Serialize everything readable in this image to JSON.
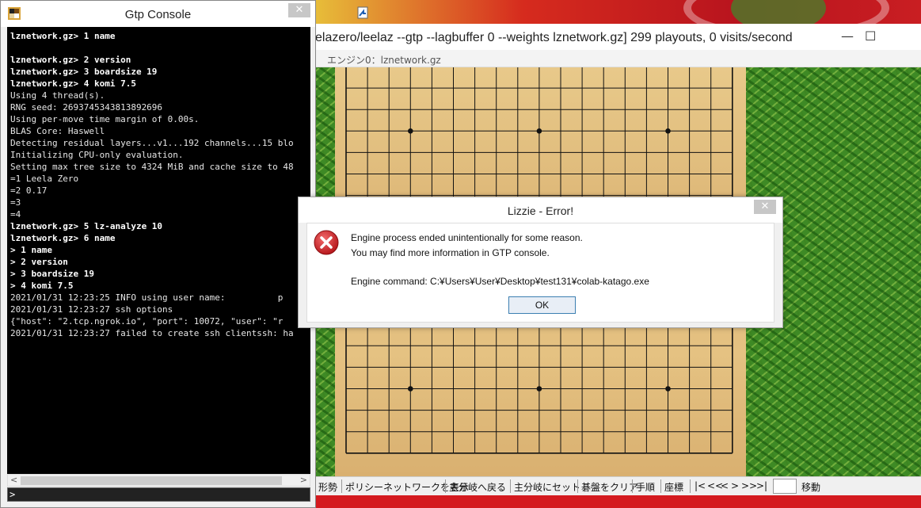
{
  "gtp_console": {
    "title": "Gtp Console",
    "close_label": "✕",
    "lines": [
      {
        "text": "lznetwork.gz> 1 name",
        "bold": true
      },
      {
        "text": "",
        "bold": false
      },
      {
        "text": "lznetwork.gz> 2 version",
        "bold": true
      },
      {
        "text": "lznetwork.gz> 3 boardsize 19",
        "bold": true
      },
      {
        "text": "lznetwork.gz> 4 komi 7.5",
        "bold": true
      },
      {
        "text": "Using 4 thread(s).",
        "bold": false
      },
      {
        "text": "RNG seed: 2693745343813892696",
        "bold": false
      },
      {
        "text": "Using per-move time margin of 0.00s.",
        "bold": false
      },
      {
        "text": "BLAS Core: Haswell",
        "bold": false
      },
      {
        "text": "Detecting residual layers...v1...192 channels...15 blo",
        "bold": false
      },
      {
        "text": "Initializing CPU-only evaluation.",
        "bold": false
      },
      {
        "text": "Setting max tree size to 4324 MiB and cache size to 48",
        "bold": false
      },
      {
        "text": "=1 Leela Zero",
        "bold": false
      },
      {
        "text": "=2 0.17",
        "bold": false
      },
      {
        "text": "=3",
        "bold": false
      },
      {
        "text": "=4",
        "bold": false
      },
      {
        "text": "lznetwork.gz> 5 lz-analyze 10",
        "bold": true
      },
      {
        "text": "lznetwork.gz> 6 name",
        "bold": true
      },
      {
        "text": "> 1 name",
        "bold": true
      },
      {
        "text": "> 2 version",
        "bold": true
      },
      {
        "text": "> 3 boardsize 19",
        "bold": true
      },
      {
        "text": "> 4 komi 7.5",
        "bold": true
      },
      {
        "text": "2021/01/31 12:23:25 INFO using user name:          p",
        "bold": false
      },
      {
        "text": "2021/01/31 12:23:27 ssh options",
        "bold": false
      },
      {
        "text": "{\"host\": \"2.tcp.ngrok.io\", \"port\": 10072, \"user\": \"r",
        "bold": false
      },
      {
        "text": "2021/01/31 12:23:27 failed to create ssh clientssh: ha",
        "bold": false
      }
    ],
    "input_prompt": ">",
    "scroll_left": "<",
    "scroll_right": ">"
  },
  "lizzie": {
    "title": "elazero/leelaz --gtp --lagbuffer 0 --weights lznetwork.gz] 299 playouts, 0 visits/second",
    "engine_label": "エンジン0：lznetwork.gz",
    "window_controls": {
      "minimize": "—",
      "maximize": "☐"
    },
    "board": {
      "size": 19,
      "star_points": [
        [
          3,
          3
        ],
        [
          9,
          3
        ],
        [
          15,
          3
        ],
        [
          3,
          9
        ],
        [
          9,
          9
        ],
        [
          15,
          9
        ],
        [
          3,
          15
        ],
        [
          9,
          15
        ],
        [
          15,
          15
        ]
      ]
    },
    "toolbar": {
      "items": [
        "形勢",
        "ポリシーネットワークを表示",
        "主分岐へ戻る",
        "主分岐にセット",
        "碁盤をクリア",
        "手順",
        "座標"
      ],
      "nav": [
        "|<",
        "<<",
        "<",
        ">",
        ">>",
        ">|"
      ],
      "move_button": "移動"
    }
  },
  "error_dialog": {
    "title": "Lizzie - Error!",
    "close_label": "✕",
    "message_line1": "Engine process ended unintentionally for some reason.",
    "message_line2": "You may find more information in GTP console.",
    "command_label": "Engine command: C:¥Users¥User¥Desktop¥test131¥colab-katago.exe",
    "ok_label": "OK",
    "icon": "error-icon"
  },
  "colors": {
    "error_red": "#c62828",
    "console_bg": "#000000",
    "accent_blue": "#3c7fb1"
  }
}
